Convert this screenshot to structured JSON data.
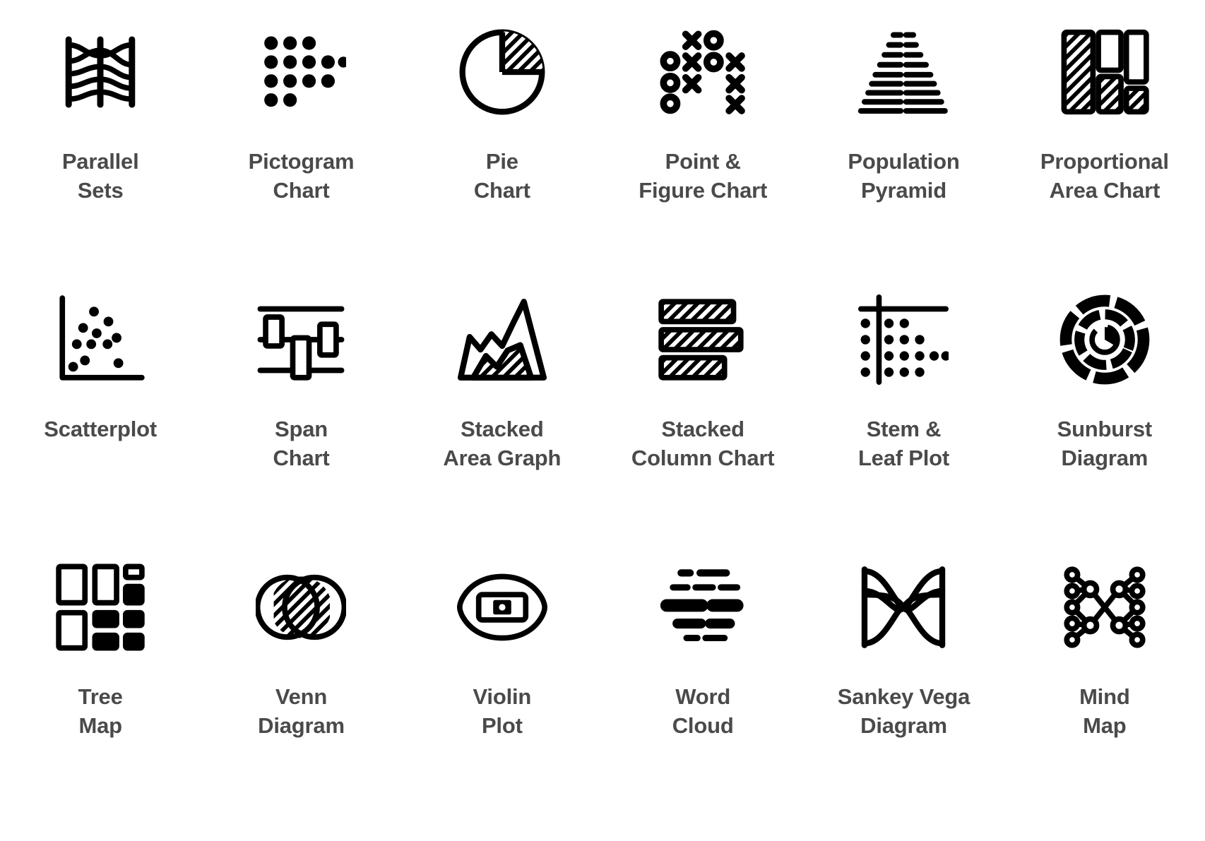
{
  "page": {
    "title": "Chart Type Icon Set",
    "background_color": "#ffffff",
    "icon_color": "#000000",
    "label_color": "#4a4a4a",
    "columns": 6,
    "rows": 3
  },
  "items": [
    {
      "icon": "parallel-sets-icon",
      "line1": "Parallel",
      "line2": "Sets"
    },
    {
      "icon": "pictogram-chart-icon",
      "line1": "Pictogram",
      "line2": "Chart"
    },
    {
      "icon": "pie-chart-icon",
      "line1": "Pie",
      "line2": "Chart"
    },
    {
      "icon": "point-and-figure-chart-icon",
      "line1": "Point &",
      "line2": "Figure Chart"
    },
    {
      "icon": "population-pyramid-icon",
      "line1": "Population",
      "line2": "Pyramid"
    },
    {
      "icon": "proportional-area-chart-icon",
      "line1": "Proportional",
      "line2": "Area Chart"
    },
    {
      "icon": "scatterplot-icon",
      "line1": "Scatterplot",
      "line2": ""
    },
    {
      "icon": "span-chart-icon",
      "line1": "Span",
      "line2": "Chart"
    },
    {
      "icon": "stacked-area-graph-icon",
      "line1": "Stacked",
      "line2": "Area Graph"
    },
    {
      "icon": "stacked-column-chart-icon",
      "line1": "Stacked",
      "line2": "Column Chart"
    },
    {
      "icon": "stem-and-leaf-plot-icon",
      "line1": "Stem &",
      "line2": "Leaf Plot"
    },
    {
      "icon": "sunburst-diagram-icon",
      "line1": "Sunburst",
      "line2": "Diagram"
    },
    {
      "icon": "tree-map-icon",
      "line1": "Tree",
      "line2": "Map"
    },
    {
      "icon": "venn-diagram-icon",
      "line1": "Venn",
      "line2": "Diagram"
    },
    {
      "icon": "violin-plot-icon",
      "line1": "Violin",
      "line2": "Plot"
    },
    {
      "icon": "word-cloud-icon",
      "line1": "Word",
      "line2": "Cloud"
    },
    {
      "icon": "sankey-vega-diagram-icon",
      "line1": "Sankey Vega",
      "line2": "Diagram"
    },
    {
      "icon": "mind-map-icon",
      "line1": "Mind",
      "line2": "Map"
    }
  ]
}
